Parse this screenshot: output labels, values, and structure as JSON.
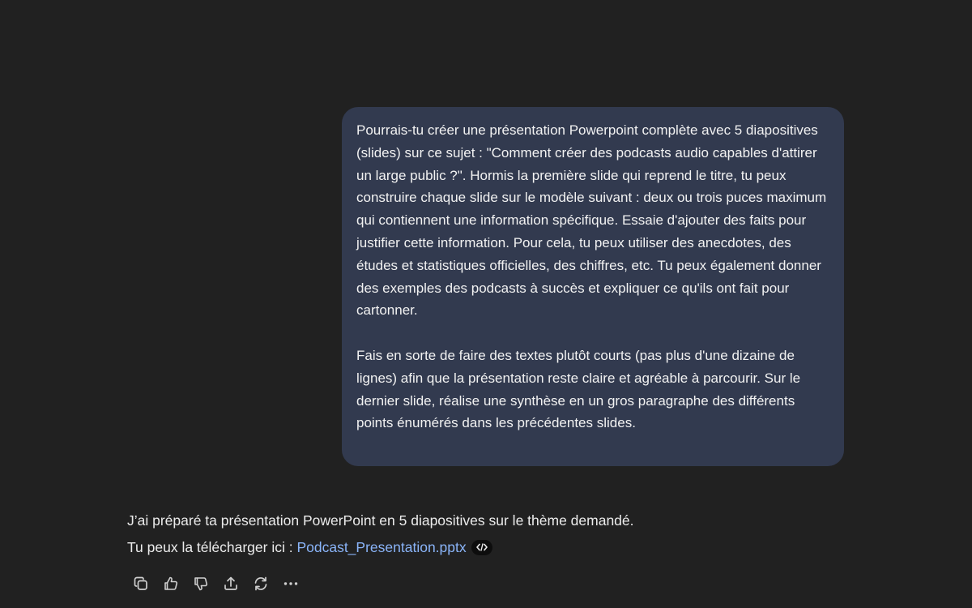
{
  "user_message": {
    "paragraphs": [
      "Pourrais-tu créer une présentation Powerpoint complète avec 5 diapositives (slides) sur ce sujet : \"Comment créer des podcasts audio capables d'attirer un large public ?\". Hormis la première slide qui reprend le titre, tu peux construire chaque slide sur le modèle suivant : deux ou trois puces maximum qui contiennent une information spécifique. Essaie d'ajouter des faits pour justifier cette information. Pour cela, tu peux utiliser des anecdotes, des études et statistiques officielles, des chiffres, etc. Tu peux également donner des exemples des podcasts à succès et expliquer ce qu'ils ont fait pour cartonner.",
      "Fais en sorte de faire des textes plutôt courts (pas plus d'une dizaine de lignes) afin que la présentation reste claire et agréable à parcourir. Sur le dernier slide, réalise une synthèse en un gros paragraphe des différents points énumérés dans les précédentes slides."
    ]
  },
  "assistant_message": {
    "line1": "J’ai préparé ta présentation PowerPoint en 5 diapositives sur le thème demandé.",
    "line2_prefix": "Tu peux la télécharger ici : ",
    "file_link": "Podcast_Presentation.pptx",
    "code_badge_icon": "code-icon"
  },
  "actions": [
    {
      "name": "copy-button",
      "icon": "copy-icon"
    },
    {
      "name": "thumbs-up-button",
      "icon": "thumbs-up-icon"
    },
    {
      "name": "thumbs-down-button",
      "icon": "thumbs-down-icon"
    },
    {
      "name": "share-button",
      "icon": "share-icon"
    },
    {
      "name": "regenerate-button",
      "icon": "refresh-icon"
    },
    {
      "name": "more-options-button",
      "icon": "more-icon"
    }
  ],
  "colors": {
    "background": "#212121",
    "user_bubble": "#323a4f",
    "link": "#8ab4f8",
    "text": "#ececec"
  }
}
